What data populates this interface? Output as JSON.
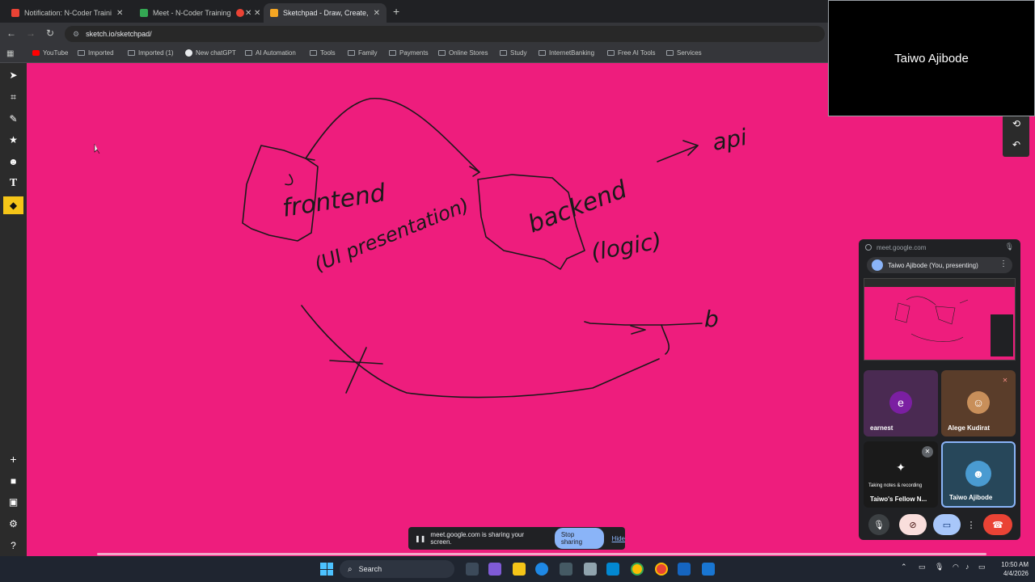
{
  "tabs": [
    {
      "title": "Notification: N-Coder Training",
      "color": "#ea4335"
    },
    {
      "title": "Meet - N-Coder Training",
      "color": "#34a853"
    },
    {
      "title": "",
      "color": "#ea4335"
    },
    {
      "title": "Sketchpad - Draw, Create, Share",
      "color": "#f5a623"
    }
  ],
  "address": {
    "url": "sketch.io/sketchpad/"
  },
  "bookmarks": [
    "YouTube",
    "Imported",
    "Imported (1)",
    "New chatGPT",
    "AI Automation",
    "Tools",
    "Family",
    "Payments",
    "Online Stores",
    "Study",
    "InternetBanking",
    "Free AI Tools",
    "Services"
  ],
  "canvas": {
    "background": "#ee1d7d"
  },
  "sketch_words": {
    "frontend": "frontend",
    "ui_presentation": "(UI presentation)",
    "backend": "backend",
    "logic": "(logic)",
    "api": "api",
    "db": "b"
  },
  "tile": {
    "name": "Taiwo Ajibode"
  },
  "meet": {
    "url": "meet.google.com",
    "presenting_label": "Taiwo Ajibode (You, presenting)",
    "participants": [
      {
        "name": "earnest",
        "initial": "e",
        "color": "#7b1fa2"
      },
      {
        "name": "Alege Kudirat"
      },
      {
        "name": "Taiwo's Fellow N...",
        "sublabel": "Taking notes & recording"
      },
      {
        "name": "Taiwo Ajibode"
      }
    ]
  },
  "sharebar": {
    "text": "meet.google.com is sharing your screen.",
    "stop": "Stop sharing",
    "hide": "Hide"
  },
  "taskbar": {
    "search": "Search",
    "time": "10:50 AM",
    "date": "4/4/2026"
  }
}
